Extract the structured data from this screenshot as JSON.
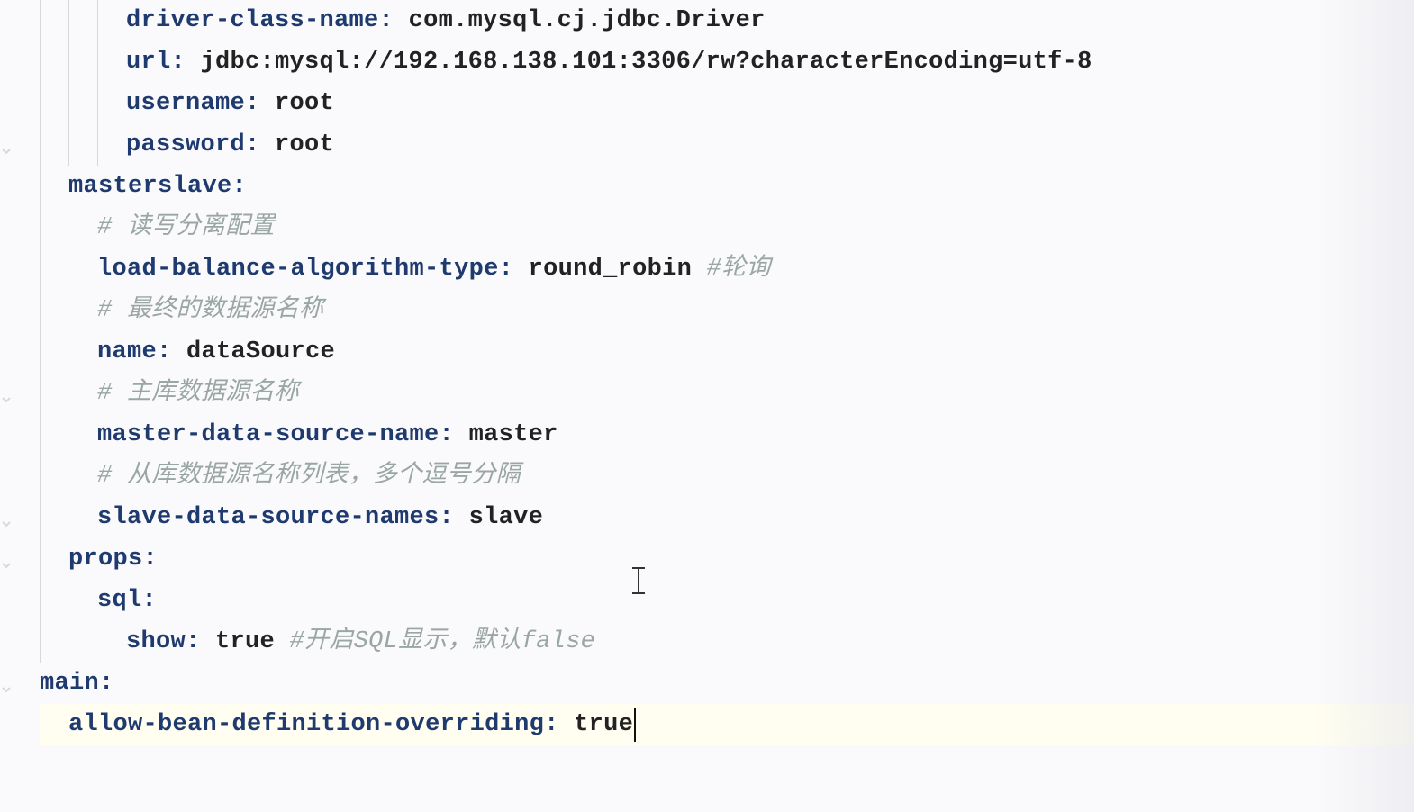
{
  "code": {
    "lines": [
      {
        "indent": 3,
        "guides": [
          true,
          true,
          true
        ],
        "key": "driver-class-name:",
        "val": " com.mysql.cj.jdbc.Driver",
        "comment": "",
        "current": false
      },
      {
        "indent": 3,
        "guides": [
          true,
          true,
          true
        ],
        "key": "url:",
        "val": " jdbc:mysql://192.168.138.101:3306/rw?characterEncoding=utf-8",
        "comment": "",
        "current": false
      },
      {
        "indent": 3,
        "guides": [
          true,
          true,
          true
        ],
        "key": "username:",
        "val": " root",
        "comment": "",
        "current": false
      },
      {
        "indent": 3,
        "guides": [
          true,
          true,
          true
        ],
        "key": "password:",
        "val": " root",
        "comment": "",
        "current": false
      },
      {
        "indent": 1,
        "guides": [
          true
        ],
        "key": "masterslave:",
        "val": "",
        "comment": "",
        "current": false
      },
      {
        "indent": 2,
        "guides": [
          true,
          false
        ],
        "key": "",
        "val": "",
        "comment": "# 读写分离配置",
        "current": false
      },
      {
        "indent": 2,
        "guides": [
          true,
          false
        ],
        "key": "load-balance-algorithm-type:",
        "val": " round_robin ",
        "comment": "#轮询",
        "current": false
      },
      {
        "indent": 2,
        "guides": [
          true,
          false
        ],
        "key": "",
        "val": "",
        "comment": "# 最终的数据源名称",
        "current": false
      },
      {
        "indent": 2,
        "guides": [
          true,
          false
        ],
        "key": "name:",
        "val": " dataSource",
        "comment": "",
        "current": false
      },
      {
        "indent": 2,
        "guides": [
          true,
          false
        ],
        "key": "",
        "val": "",
        "comment": "# 主库数据源名称",
        "current": false
      },
      {
        "indent": 2,
        "guides": [
          true,
          false
        ],
        "key": "master-data-source-name:",
        "val": " master",
        "comment": "",
        "current": false
      },
      {
        "indent": 2,
        "guides": [
          true,
          false
        ],
        "key": "",
        "val": "",
        "comment": "# 从库数据源名称列表，多个逗号分隔",
        "current": false
      },
      {
        "indent": 2,
        "guides": [
          true,
          false
        ],
        "key": "slave-data-source-names:",
        "val": " slave",
        "comment": "",
        "current": false
      },
      {
        "indent": 1,
        "guides": [
          true
        ],
        "key": "props:",
        "val": "",
        "comment": "",
        "current": false
      },
      {
        "indent": 2,
        "guides": [
          true,
          false
        ],
        "key": "sql:",
        "val": "",
        "comment": "",
        "current": false
      },
      {
        "indent": 3,
        "guides": [
          true,
          false,
          false
        ],
        "key": "show:",
        "val": " true ",
        "comment": "#开启SQL显示，默认false",
        "current": false
      },
      {
        "indent": 0,
        "guides": [],
        "key": "main:",
        "val": "",
        "comment": "",
        "current": false
      },
      {
        "indent": 1,
        "guides": [
          false
        ],
        "key": "allow-bean-definition-overriding:",
        "val": " true",
        "comment": "",
        "current": true
      }
    ]
  },
  "gutter": {
    "icons": [
      {
        "line": 3,
        "name": "fold-icon"
      },
      {
        "line": 9,
        "name": "fold-icon"
      },
      {
        "line": 12,
        "name": "fold-icon"
      },
      {
        "line": 13,
        "name": "fold-icon"
      },
      {
        "line": 16,
        "name": "fold-icon"
      }
    ]
  },
  "cursor": {
    "visible": true
  }
}
